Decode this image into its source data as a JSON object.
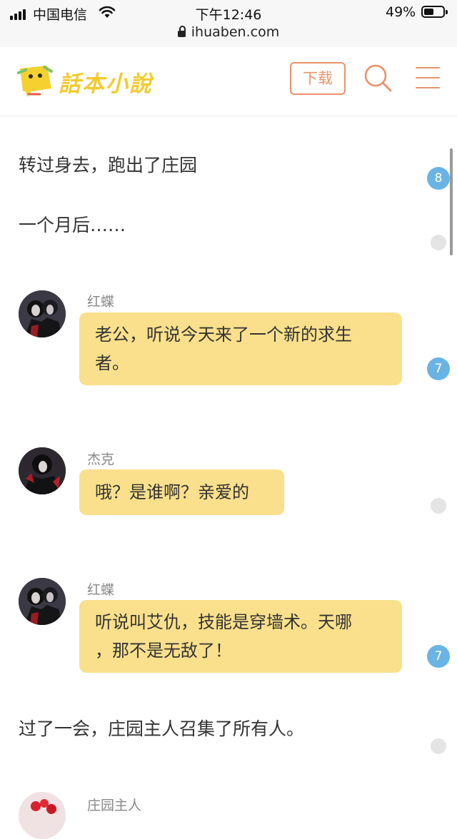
{
  "status_bar": {
    "carrier": "中国电信",
    "time": "下午12:46",
    "battery": "49%",
    "battery_level": 0.49,
    "url": "ihuaben.com"
  },
  "header": {
    "logo_text": "話本小說",
    "download_label": "下载",
    "icons": [
      "logo-icon",
      "search-icon",
      "menu-icon"
    ],
    "accent_color": "#e7936a"
  },
  "story": {
    "paragraph_1": "转过身去，跑出了庄园",
    "paragraph_1_badge": "8",
    "paragraph_2": "一个月后……",
    "msg_1": {
      "speaker": "红蝶",
      "line_1": "老公，听说今天来了一个新的求生",
      "line_2": "者。",
      "badge": "7"
    },
    "msg_2": {
      "speaker": "杰克",
      "line_1": "哦？是谁啊？亲爱的"
    },
    "msg_3": {
      "speaker": "红蝶",
      "line_1": "听说叫艾仇，技能是穿墙术。天哪",
      "line_2": "，那不是无敌了！",
      "badge": "7"
    },
    "paragraph_3": "过了一会，庄园主人召集了所有人。",
    "msg_4": {
      "speaker": "庄园主人"
    },
    "bubble_color": "#fae08c",
    "badge_color": "#6ab4e5"
  }
}
